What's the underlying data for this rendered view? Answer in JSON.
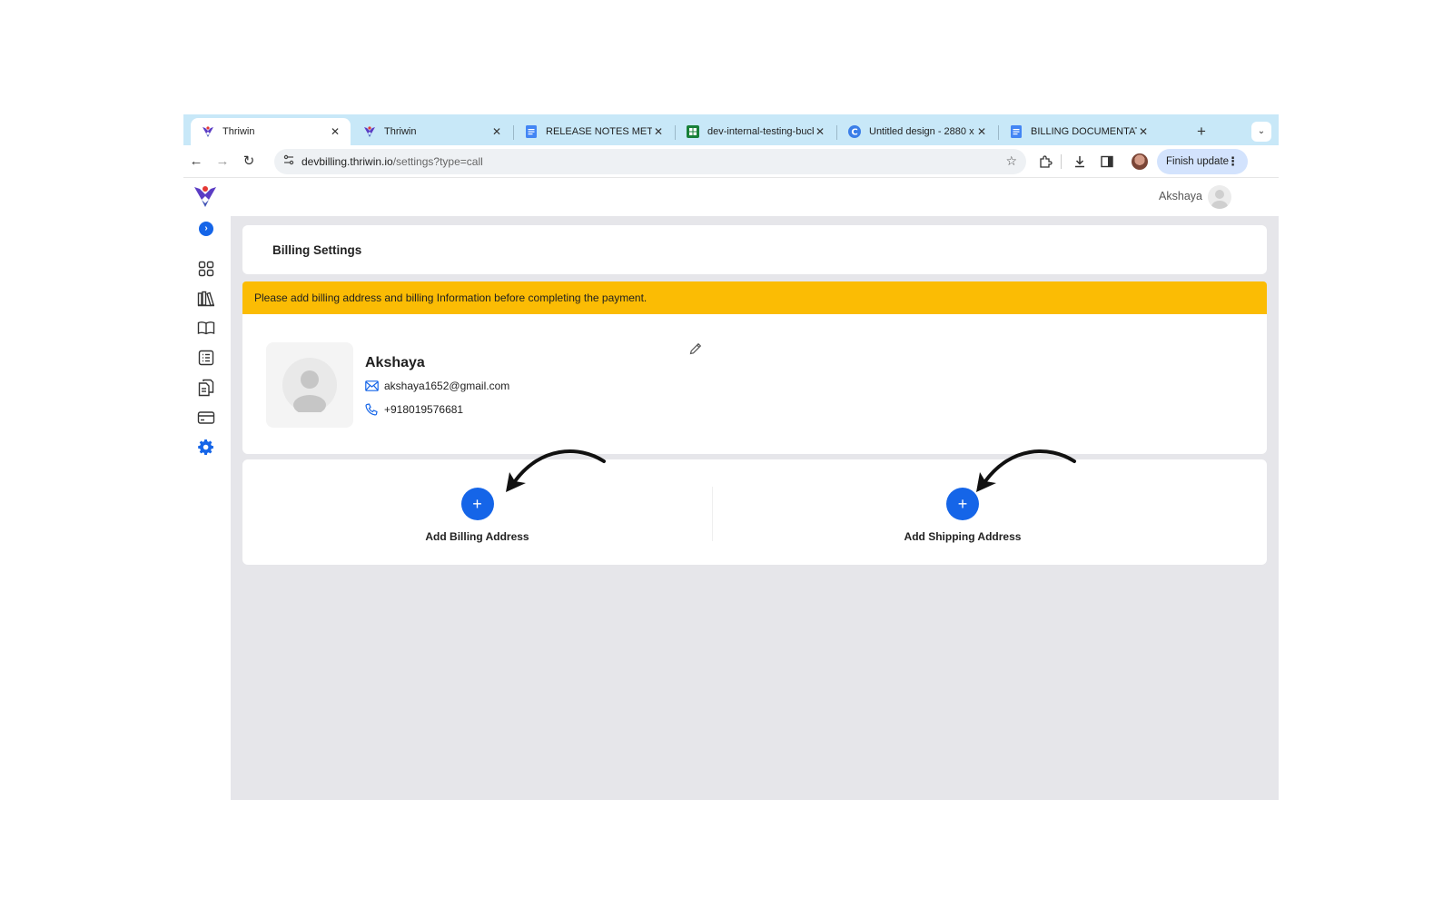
{
  "browser": {
    "tabs": [
      {
        "title": "Thriwin",
        "active": true,
        "icon": "thriwin-logo-icon"
      },
      {
        "title": "Thriwin",
        "active": false,
        "icon": "thriwin-logo-icon"
      },
      {
        "title": "RELEASE NOTES METER -",
        "active": false,
        "icon": "google-docs-icon"
      },
      {
        "title": "dev-internal-testing-buck",
        "active": false,
        "icon": "google-sheets-icon"
      },
      {
        "title": "Untitled design - 2880 x",
        "active": false,
        "icon": "canva-icon"
      },
      {
        "title": "BILLING DOCUMENTATIO",
        "active": false,
        "icon": "google-docs-icon"
      }
    ],
    "url_host": "devbilling.thriwin.io",
    "url_path": "/settings?type=call",
    "finish_update_label": "Finish update"
  },
  "header": {
    "user_name": "Akshaya"
  },
  "sidebar": {
    "items": [
      {
        "icon": "dashboard-grid-icon",
        "active": false
      },
      {
        "icon": "library-icon",
        "active": false
      },
      {
        "icon": "book-icon",
        "active": false
      },
      {
        "icon": "list-icon",
        "active": false
      },
      {
        "icon": "documents-icon",
        "active": false
      },
      {
        "icon": "credit-card-icon",
        "active": false
      },
      {
        "icon": "settings-gear-icon",
        "active": true
      }
    ]
  },
  "main": {
    "title": "Billing Settings",
    "warning": "Please add billing address and billing Information before completing the payment.",
    "profile": {
      "name": "Akshaya",
      "email": "akshaya1652@gmail.com",
      "phone": "+918019576681"
    },
    "add_billing_label": "Add Billing Address",
    "add_shipping_label": "Add Shipping Address",
    "add_button_symbol": "+"
  },
  "colors": {
    "accent": "#1565e8",
    "warning": "#fbbc04",
    "tabstrip": "#c8e8f8",
    "content_bg": "#e6e6ea"
  }
}
